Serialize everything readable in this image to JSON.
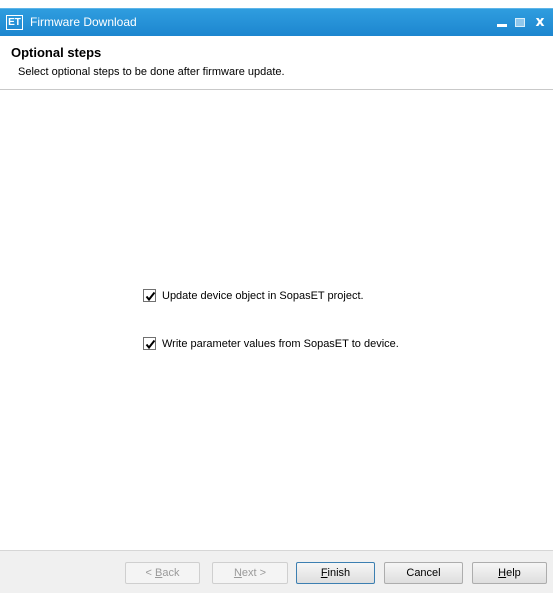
{
  "window": {
    "title": "Firmware Download",
    "app_icon_text": "ET",
    "close_glyph": "x"
  },
  "header": {
    "title": "Optional steps",
    "description": "Select optional steps to be done after firmware update."
  },
  "options": [
    {
      "label": "Update device object in SopasET project.",
      "checked": true
    },
    {
      "label": "Write parameter values from SopasET to device.",
      "checked": true
    }
  ],
  "buttons": {
    "back": {
      "prefix": "< ",
      "mnemonic": "B",
      "rest": "ack",
      "enabled": false
    },
    "next": {
      "prefix": "",
      "mnemonic": "N",
      "rest": "ext >",
      "enabled": false
    },
    "finish": {
      "prefix": "",
      "mnemonic": "F",
      "rest": "inish",
      "enabled": true
    },
    "cancel": {
      "label": "Cancel",
      "enabled": true
    },
    "help": {
      "prefix": "",
      "mnemonic": "H",
      "rest": "elp",
      "enabled": true
    }
  },
  "colors": {
    "titlebar": "#1d86cf",
    "footer": "#f0f0f0",
    "checkmark": "#000000"
  },
  "icons": {
    "app": "app-et-icon",
    "minimize": "minimize-icon",
    "maximize": "maximize-icon",
    "close": "close-icon",
    "check": "checkmark-icon"
  }
}
